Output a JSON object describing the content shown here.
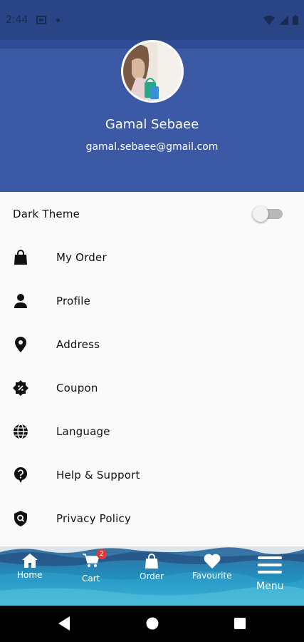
{
  "status_bar": {
    "time": "2:44"
  },
  "profile": {
    "name": "Gamal Sebaee",
    "email": "gamal.sebaee@gmail.com"
  },
  "settings": {
    "dark_theme_label": "Dark Theme",
    "dark_theme_on": false
  },
  "menu": {
    "items": [
      {
        "label": "My Order",
        "icon": "shopping-bag-icon"
      },
      {
        "label": "Profile",
        "icon": "person-icon"
      },
      {
        "label": "Address",
        "icon": "location-pin-icon"
      },
      {
        "label": "Coupon",
        "icon": "coupon-icon"
      },
      {
        "label": "Language",
        "icon": "globe-icon"
      },
      {
        "label": "Help & Support",
        "icon": "help-icon"
      },
      {
        "label": "Privacy Policy",
        "icon": "privacy-shield-icon"
      }
    ]
  },
  "bottom_nav": {
    "home": "Home",
    "cart": "Cart",
    "cart_badge": "2",
    "order": "Order",
    "favourite": "Favourite",
    "menu": "Menu"
  },
  "colors": {
    "header": "#3b59a5",
    "status_bar": "#2a4585",
    "toggle_track": "#b9b9b9"
  }
}
